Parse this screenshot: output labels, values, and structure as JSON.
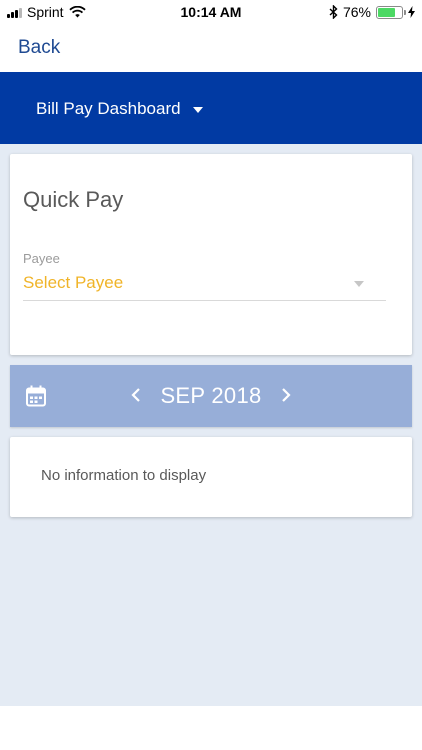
{
  "status_bar": {
    "carrier": "Sprint",
    "time": "10:14 AM",
    "battery": "76%",
    "battery_level": 0.76,
    "icons": [
      "signal-icon",
      "wifi-icon",
      "bluetooth-icon",
      "battery-icon",
      "charging-bolt-icon"
    ]
  },
  "nav": {
    "back_label": "Back"
  },
  "header": {
    "title": "Bill Pay Dashboard",
    "icon": "caret-down-icon"
  },
  "quick_pay": {
    "title": "Quick Pay",
    "payee_label": "Payee",
    "payee_value": "Select Payee",
    "payee_value_color": "#f0b429"
  },
  "month_nav": {
    "month": "SEP 2018",
    "calendar_icon": "calendar-icon",
    "prev_icon": "chevron-left-icon",
    "next_icon": "chevron-right-icon"
  },
  "empty_state": {
    "text": "No information to display"
  },
  "colors": {
    "header_bg": "#013aa3",
    "month_bar_bg": "#97aed8",
    "content_bg": "#e4ebf4",
    "back_link": "#1f4a92"
  }
}
